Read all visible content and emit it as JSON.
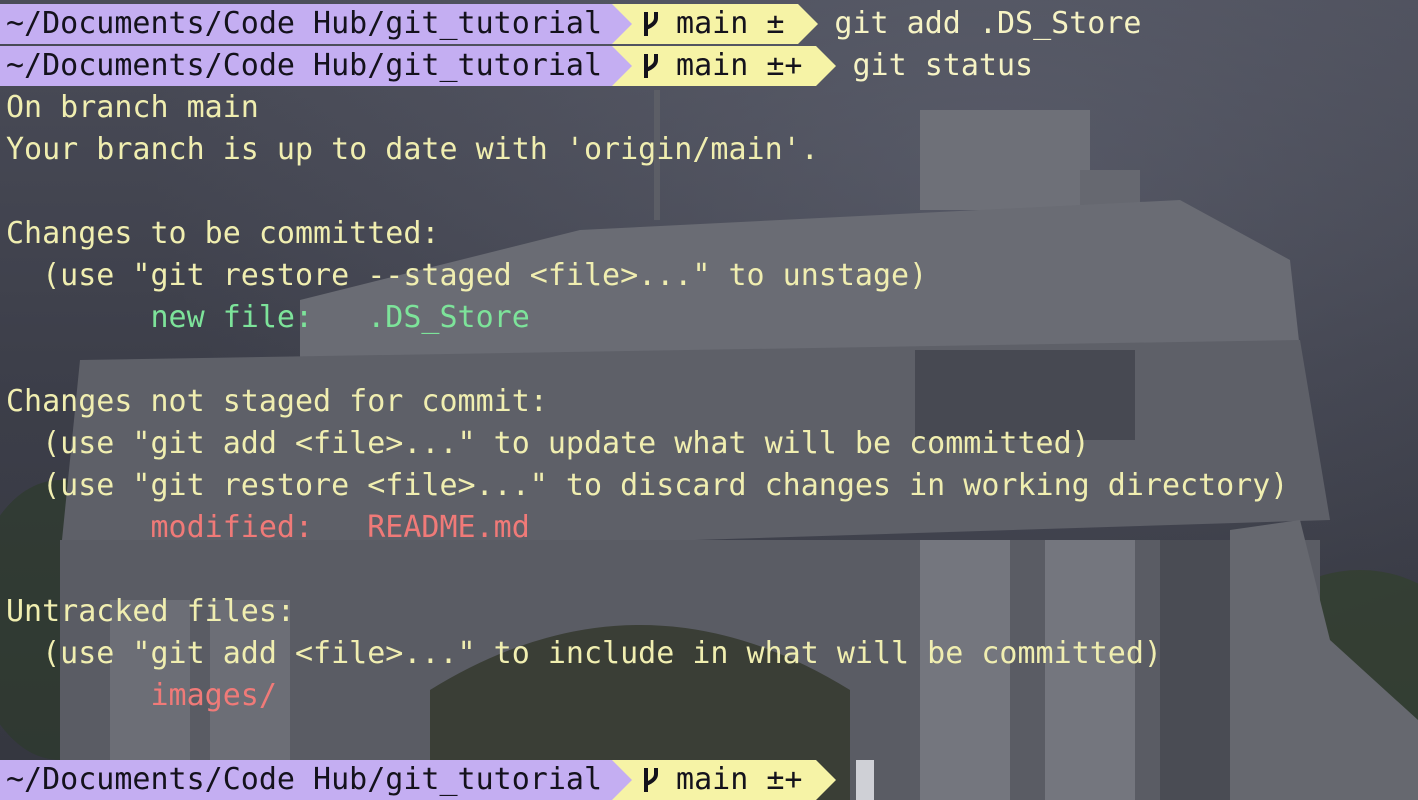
{
  "prompts": [
    {
      "path": "~/Documents/Code Hub/git_tutorial",
      "branch": "main",
      "status": "±",
      "command": "git add .DS_Store"
    },
    {
      "path": "~/Documents/Code Hub/git_tutorial",
      "branch": "main",
      "status": "±+",
      "command": "git status"
    },
    {
      "path": "~/Documents/Code Hub/git_tutorial",
      "branch": "main",
      "status": "±+",
      "command": ""
    }
  ],
  "output": {
    "branch_line": "On branch main",
    "uptodate_line": "Your branch is up to date with 'origin/main'.",
    "staged_header": "Changes to be committed:",
    "staged_hint": "  (use \"git restore --staged <file>...\" to unstage)",
    "staged_label": "        new file:   ",
    "staged_file": ".DS_Store",
    "unstaged_header": "Changes not staged for commit:",
    "unstaged_hint1": "  (use \"git add <file>...\" to update what will be committed)",
    "unstaged_hint2": "  (use \"git restore <file>...\" to discard changes in working directory)",
    "unstaged_label": "        modified:   ",
    "unstaged_file": "README.md",
    "untracked_header": "Untracked files:",
    "untracked_hint": "  (use \"git add <file>...\" to include in what will be committed)",
    "untracked_file": "        images/"
  },
  "colors": {
    "path_segment": "#c4aef2",
    "git_segment": "#f6f3a6",
    "text": "#f0eeb0",
    "staged": "#7de39a",
    "unstaged": "#f07a78"
  },
  "icons": {
    "branch": "git-branch-icon"
  }
}
